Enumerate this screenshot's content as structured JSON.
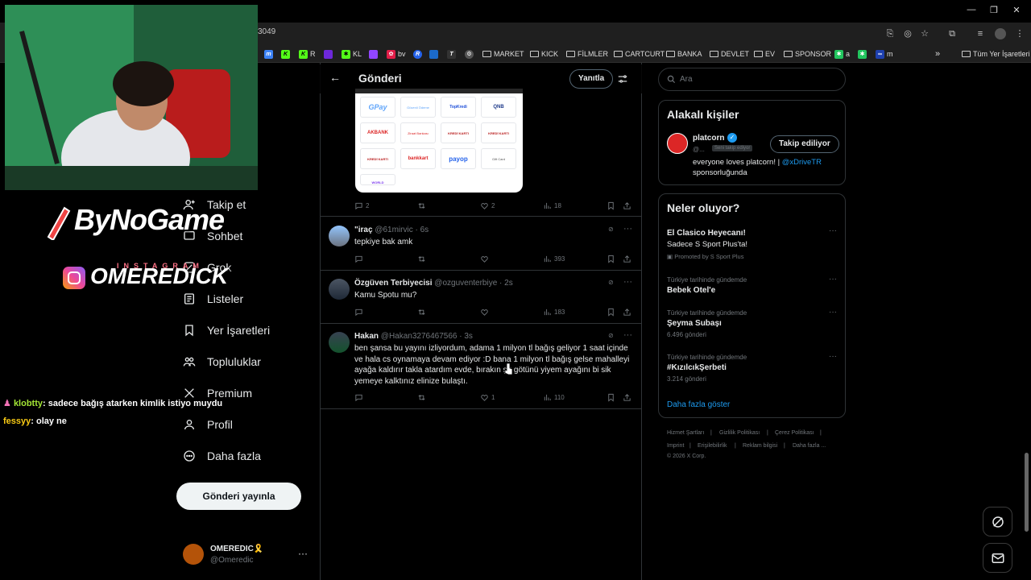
{
  "browser": {
    "url_fragment": "3049",
    "bookmarks": [
      {
        "label": "m",
        "color": "#3b82f6"
      },
      {
        "label": "",
        "color": "#53fc18"
      },
      {
        "label": "R",
        "color": "#53fc18"
      },
      {
        "label": "",
        "color": "#6d28d9"
      },
      {
        "label": "KL",
        "color": "#53fc18"
      },
      {
        "label": "",
        "color": "#9146ff"
      },
      {
        "label": "bv",
        "color": "#e11d48"
      },
      {
        "label": "",
        "color": "#2563eb"
      },
      {
        "label": "",
        "color": "#1b6ac9"
      },
      {
        "label": "",
        "color": "#333333"
      },
      {
        "label": "",
        "color": "#555555"
      }
    ],
    "folders": [
      "MARKET",
      "KICK",
      "FİLMLER",
      "CARTCURT",
      "BANKA",
      "DEVLET",
      "EV",
      "SPONSOR"
    ],
    "extra_bookmarks": [
      "a",
      "",
      "m"
    ],
    "all_bookmarks": "Tüm Yer İşaretleri"
  },
  "overlay": {
    "brand": "ByNoGame",
    "instagram_small": "INSTAGRAM",
    "instagram_handle": "OMEREDICK",
    "chat": [
      {
        "user": "klobtty",
        "message": ": sadece bağış atarken kimlik istiyo muydu",
        "color": "#a3e635"
      },
      {
        "user": "fessyy",
        "message": ": olay ne",
        "color": "#facc15"
      }
    ]
  },
  "nav": {
    "items": [
      {
        "label": "Takip et",
        "icon": "follow-icon"
      },
      {
        "label": "Sohbet",
        "icon": "chat-icon"
      },
      {
        "label": "Grok",
        "icon": "grok-icon"
      },
      {
        "label": "Listeler",
        "icon": "list-icon"
      },
      {
        "label": "Yer İşaretleri",
        "icon": "bookmark-icon"
      },
      {
        "label": "Topluluklar",
        "icon": "communities-icon"
      },
      {
        "label": "Premium",
        "icon": "x-icon"
      },
      {
        "label": "Profil",
        "icon": "profile-icon"
      },
      {
        "label": "Daha fazla",
        "icon": "more-icon"
      }
    ],
    "post_button": "Gönderi yayınla",
    "account": {
      "name": "OMEREDIC🎗️",
      "handle": "@Omeredic"
    }
  },
  "main": {
    "header_title": "Gönderi",
    "reply_button": "Yanıtla",
    "image_logos": [
      "GPay",
      "Güvenli Ödeme",
      "TopKredi",
      "QNB",
      "AKBANK",
      "Ziraat Bankası",
      "KREDİ KARTI",
      "KREDİ KARTI",
      "KREDİ KARTI",
      "bankkart",
      "payop",
      "Gift Card",
      "WORLD"
    ],
    "first_stats": {
      "replies": "2",
      "likes": "2",
      "views": "18"
    },
    "tweets": [
      {
        "name": "\"iraç",
        "handle": "@61mirvic",
        "time": "6s",
        "text": "tepkiye bak amk",
        "replies": "",
        "retweets": "",
        "likes": "",
        "views": "393"
      },
      {
        "name": "Özgüven Terbiyecisi",
        "handle": "@ozguventerbiye",
        "time": "2s",
        "text": "Kamu Spotu mu?",
        "replies": "",
        "retweets": "",
        "likes": "",
        "views": "183"
      },
      {
        "name": "Hakan",
        "handle": "@Hakan3276467566",
        "time": "3s",
        "text": "ben şansa bu yayını izliyordum, adama 1 milyon tl bağış geliyor 1 saat içinde ve hala cs oynamaya devam ediyor :D bana 1 milyon tl bağış gelse mahalleyi ayağa kaldırır takla atardım evde, bırakın şu götünü yiyem ayağını bi sik yemeye kalktınız elinize bulaştı.",
        "replies": "",
        "retweets": "",
        "likes": "1",
        "views": "110"
      }
    ]
  },
  "right": {
    "search_placeholder": "Ara",
    "relevant_title": "Alakalı kişiler",
    "person": {
      "name": "platcorn",
      "handle": "@...",
      "follows_you": "Seni takip ediyor",
      "button": "Takip ediliyor",
      "bio_pre": "everyone loves platcorn! |",
      "bio_link": "@xDriveTR",
      "bio_post": "sponsorluğunda"
    },
    "trends_title": "Neler oluyor?",
    "trends": [
      {
        "cat": "",
        "name": "El Clasico Heyecanı!",
        "sub": "Sadece S Sport Plus'ta!",
        "promo": "Promoted by S Sport Plus"
      },
      {
        "cat": "Türkiye tarihinde gündemde",
        "name": "Bebek Otel'e",
        "sub": "",
        "promo": ""
      },
      {
        "cat": "Türkiye tarihinde gündemde",
        "name": "Şeyma Subaşı",
        "sub": "6.496 gönderi",
        "promo": ""
      },
      {
        "cat": "Türkiye tarihinde gündemde",
        "name": "#KızılcıkŞerbeti",
        "sub": "3.214 gönderi",
        "promo": ""
      }
    ],
    "show_more": "Daha fazla göster",
    "footer": [
      "Hizmet Şartları",
      "Gizlilik Politikası",
      "Çerez Politikası",
      "Imprint",
      "Erişilebilirlik",
      "Reklam bilgisi",
      "Daha fazla ...",
      "© 2026 X Corp."
    ]
  }
}
